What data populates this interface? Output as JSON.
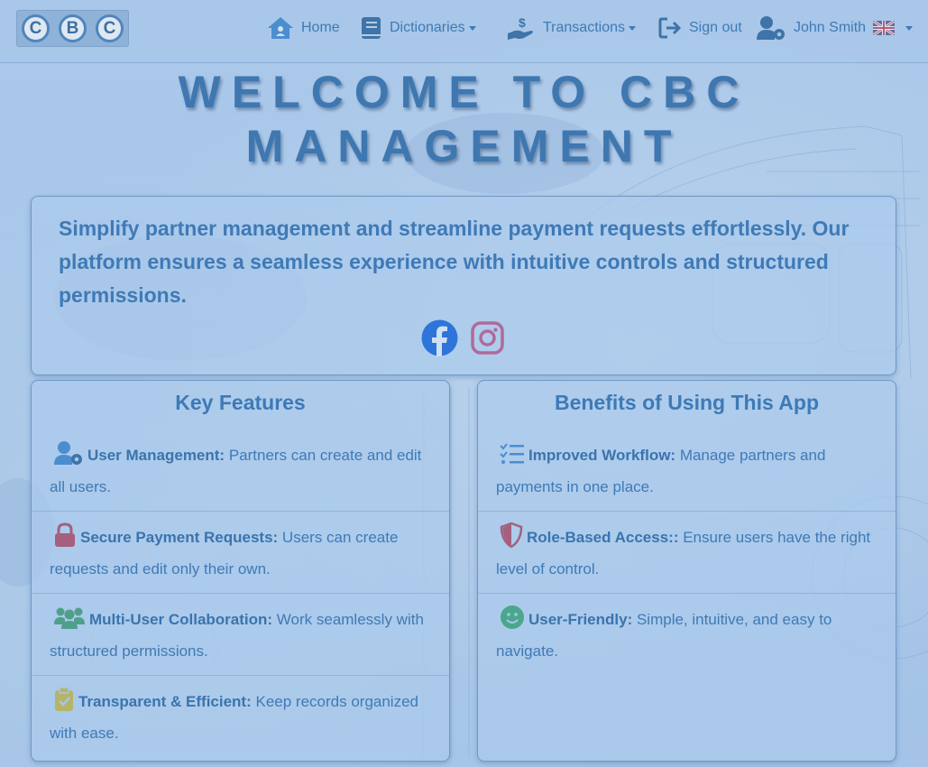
{
  "brand": {
    "logo_letters": [
      "C",
      "B",
      "C"
    ]
  },
  "nav": {
    "home": "Home",
    "dictionaries": "Dictionaries",
    "transactions": "Transactions",
    "sign_out": "Sign out",
    "user": "John Smith",
    "language_icon": "uk-flag-icon"
  },
  "hero": {
    "title_line1": "WELCOME TO CBC",
    "title_line2": "MANAGEMENT"
  },
  "intro": {
    "text": "Simplify partner management and streamline payment requests effortlessly. Our platform ensures a seamless experience with intuitive controls and structured permissions.",
    "social": [
      "facebook-icon",
      "instagram-icon"
    ]
  },
  "features": {
    "title": "Key Features",
    "items": [
      {
        "icon": "user-gear-icon",
        "title": "User Management:",
        "text": " Partners can create and edit all users."
      },
      {
        "icon": "lock-icon",
        "title": "Secure Payment Requests:",
        "text": " Users can create requests and edit only their own."
      },
      {
        "icon": "users-icon",
        "title": "Multi-User Collaboration:",
        "text": " Work seamlessly with structured permissions."
      },
      {
        "icon": "clipboard-check-icon",
        "title": "Transparent & Efficient:",
        "text": " Keep records organized with ease."
      }
    ]
  },
  "benefits": {
    "title": "Benefits of Using This App",
    "items": [
      {
        "icon": "list-check-icon",
        "title": "Improved Workflow:",
        "text": " Manage partners and payments in one place."
      },
      {
        "icon": "shield-icon",
        "title": "Role-Based Access::",
        "text": " Ensure users have the right level of control."
      },
      {
        "icon": "smile-icon",
        "title": "User-Friendly:",
        "text": " Simple, intuitive, and easy to navigate."
      }
    ]
  },
  "colors": {
    "background": "#a8c6e8",
    "text": "#3e7ab6",
    "facebook": "#2f74d8",
    "instagram": "#b06a9a",
    "lock": "#a4607e",
    "users": "#4f9f8a",
    "clipboard": "#b5b469",
    "smile": "#4aa78b"
  }
}
